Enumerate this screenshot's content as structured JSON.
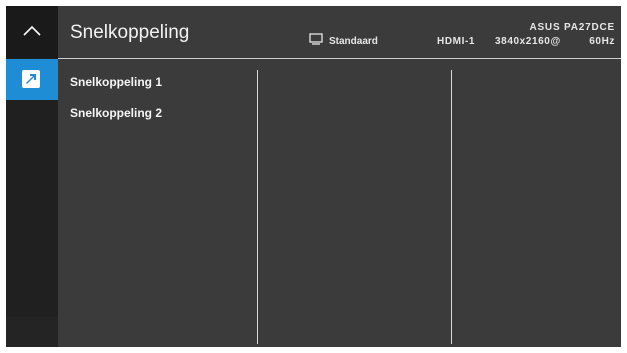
{
  "header": {
    "title": "Snelkoppeling",
    "mode": "Standaard",
    "input": "HDMI-1",
    "resolution": "3840x2160@",
    "refresh": "60Hz",
    "model": "ASUS PA27DCE"
  },
  "sidebar": {
    "items": [
      {
        "icon": "chevron-up-icon",
        "selected": false
      },
      {
        "icon": "shortcut-arrow-icon",
        "selected": true
      }
    ]
  },
  "menu": {
    "items": [
      {
        "label": "Snelkoppeling 1"
      },
      {
        "label": "Snelkoppeling 2"
      }
    ]
  },
  "colors": {
    "background": "#3b3b3b",
    "sidebar": "#202020",
    "accent": "#1f8dd6",
    "text": "#f2f2f2"
  }
}
